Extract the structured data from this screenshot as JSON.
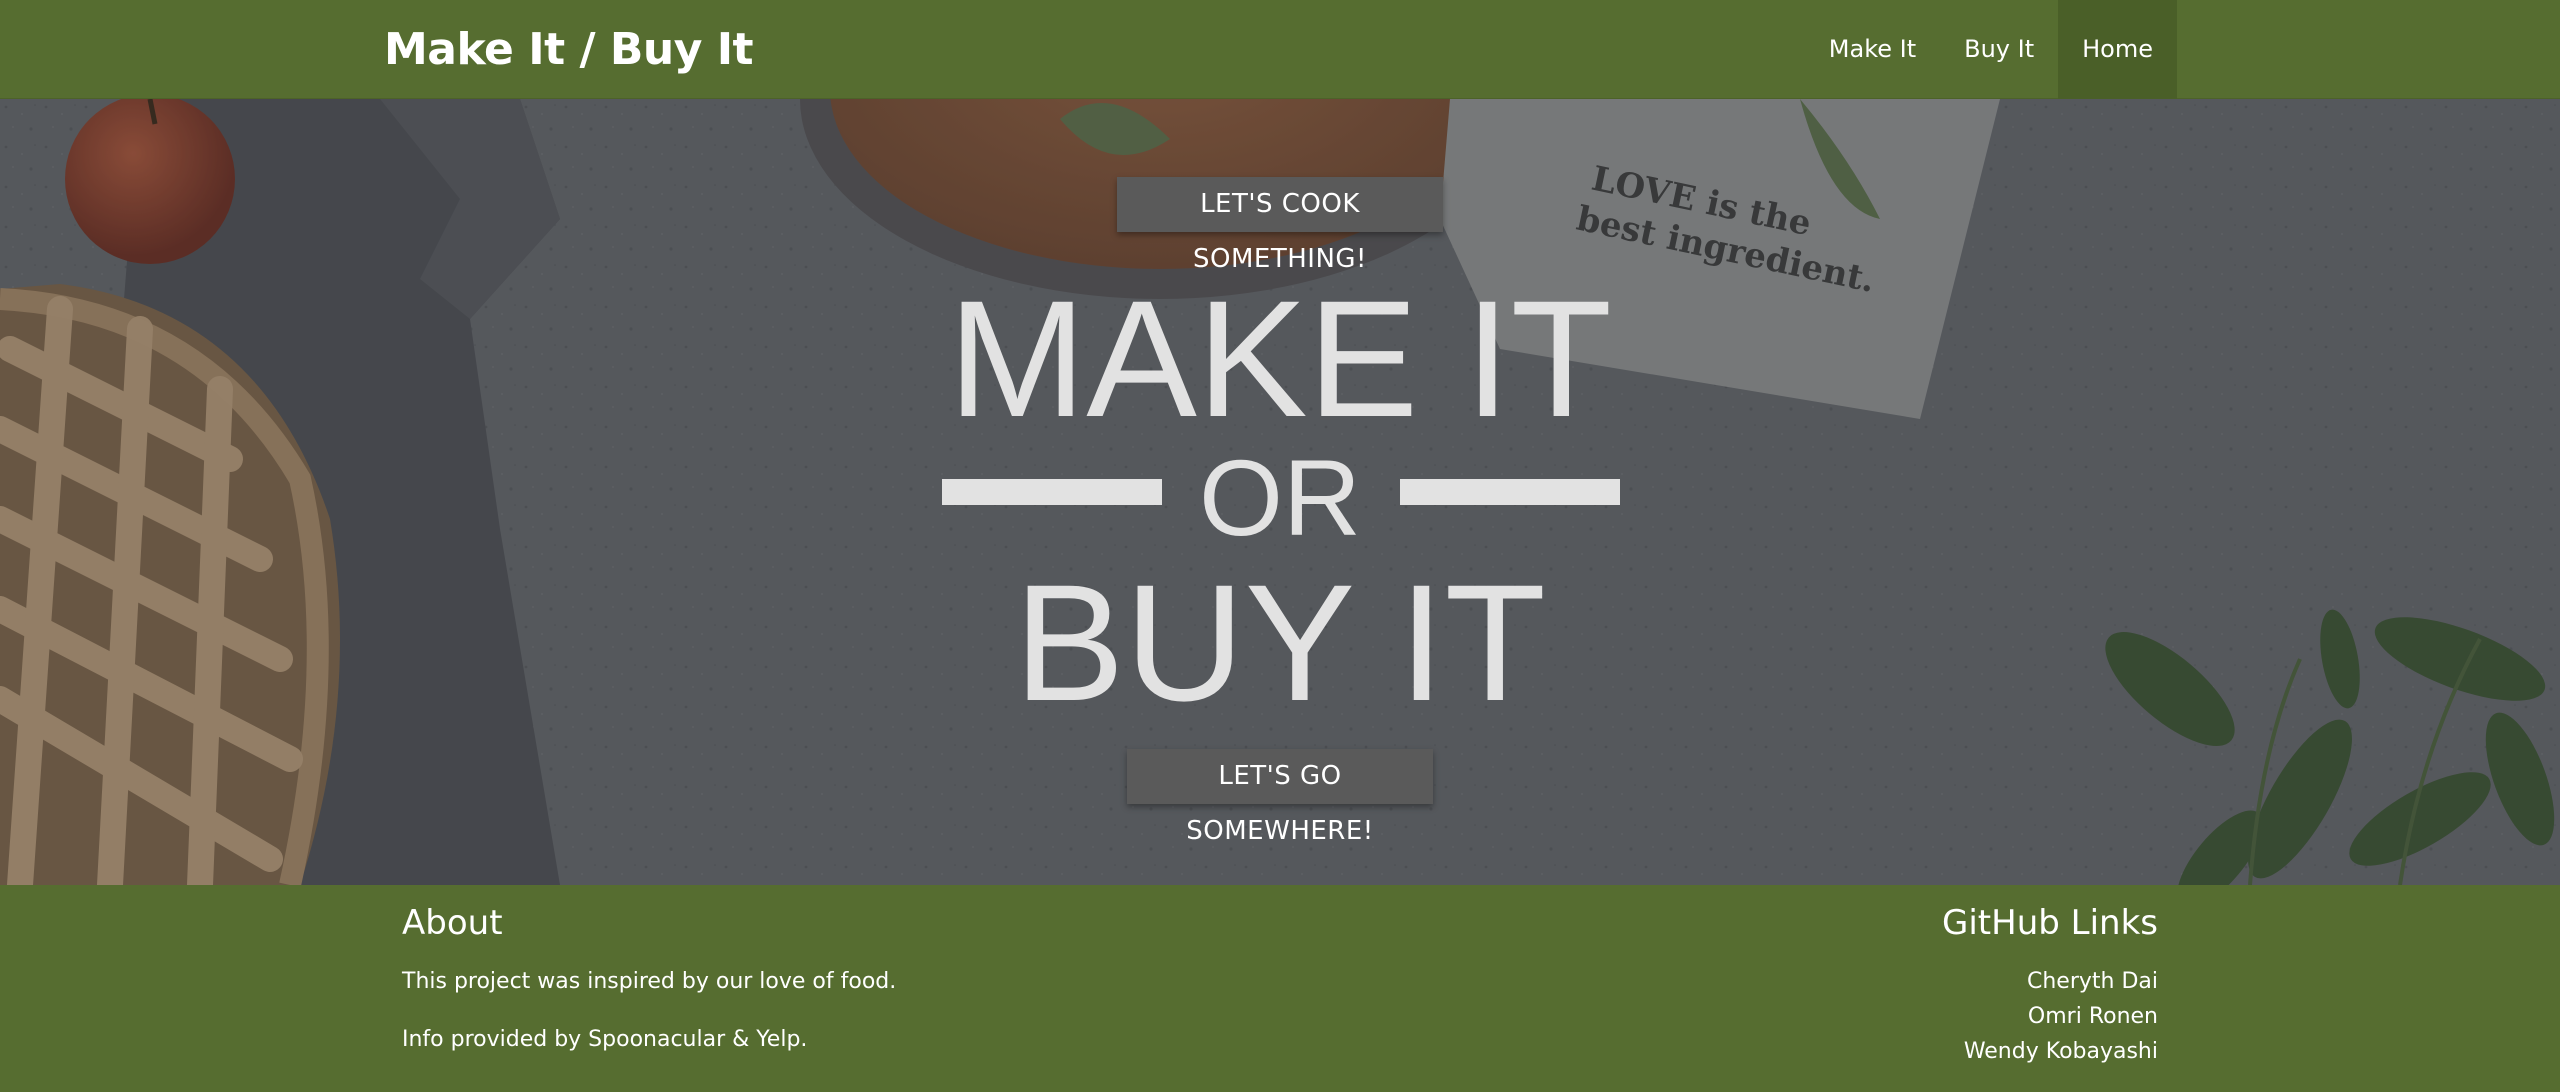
{
  "navbar": {
    "brand": "Make It / Buy It",
    "links": [
      {
        "label": "Make It",
        "active": false
      },
      {
        "label": "Buy It",
        "active": false
      },
      {
        "label": "Home",
        "active": true
      }
    ]
  },
  "hero": {
    "cook_button": "LET'S COOK SOMETHING!",
    "title_make": "MAKE IT",
    "title_or": "OR",
    "title_buy": "BUY IT",
    "go_button": "LET'S GO SOMEWHERE!",
    "towel_text_line1": "LOVE is the",
    "towel_text_line2": "best ingredient."
  },
  "footer": {
    "about": {
      "heading": "About",
      "line1": "This project was inspired by our love of food.",
      "line2": "Info provided by Spoonacular & Yelp."
    },
    "github": {
      "heading": "GitHub Links",
      "links": [
        "Cheryth Dai",
        "Omri Ronen",
        "Wendy Kobayashi"
      ]
    }
  },
  "colors": {
    "brand_green": "#566d30",
    "active_nav": "#4a5f28",
    "hero_overlay": "#5f6165",
    "button_gray": "#5a5a5a",
    "title_text": "#e2e2e2"
  }
}
